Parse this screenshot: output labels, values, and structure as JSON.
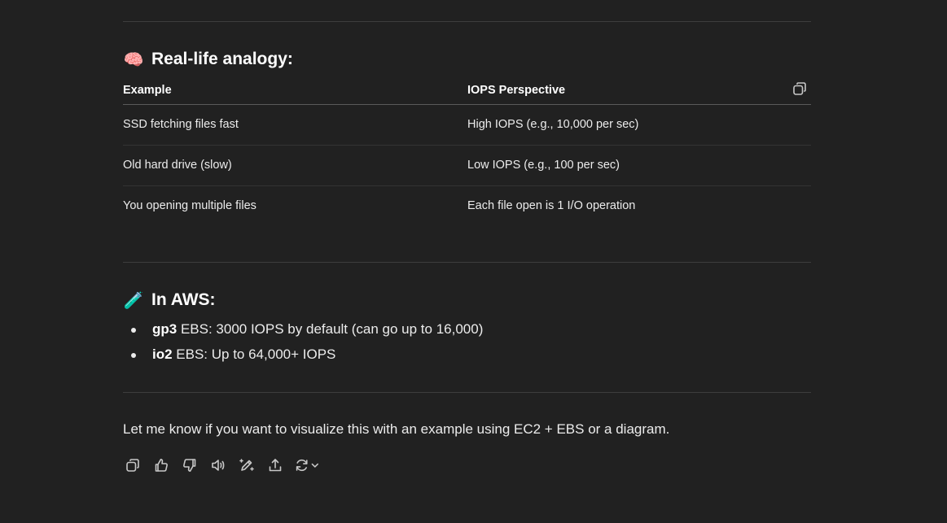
{
  "sections": {
    "analogy": {
      "emoji": "🧠",
      "title": "Real-life analogy:"
    },
    "aws": {
      "emoji": "🧪",
      "title": "In AWS:"
    }
  },
  "table": {
    "headers": [
      "Example",
      "IOPS Perspective"
    ],
    "rows": [
      [
        "SSD fetching files fast",
        "High IOPS (e.g., 10,000 per sec)"
      ],
      [
        "Old hard drive (slow)",
        "Low IOPS (e.g., 100 per sec)"
      ],
      [
        "You opening multiple files",
        "Each file open is 1 I/O operation"
      ]
    ],
    "copy_icon": "copy-icon"
  },
  "aws_list": [
    {
      "bold": "gp3",
      "text": " EBS: 3000 IOPS by default (can go up to 16,000)"
    },
    {
      "bold": "io2",
      "text": " EBS: Up to 64,000+ IOPS"
    }
  ],
  "closing_text": "Let me know if you want to visualize this with an example using EC2 + EBS or a diagram.",
  "actions": [
    {
      "name": "copy",
      "icon": "copy-icon"
    },
    {
      "name": "good-response",
      "icon": "thumbs-up-icon"
    },
    {
      "name": "bad-response",
      "icon": "thumbs-down-icon"
    },
    {
      "name": "read-aloud",
      "icon": "speaker-icon"
    },
    {
      "name": "edit-in-canvas",
      "icon": "pen-sparkle-icon"
    },
    {
      "name": "share",
      "icon": "share-icon"
    },
    {
      "name": "regenerate",
      "icon": "refresh-icon"
    }
  ]
}
